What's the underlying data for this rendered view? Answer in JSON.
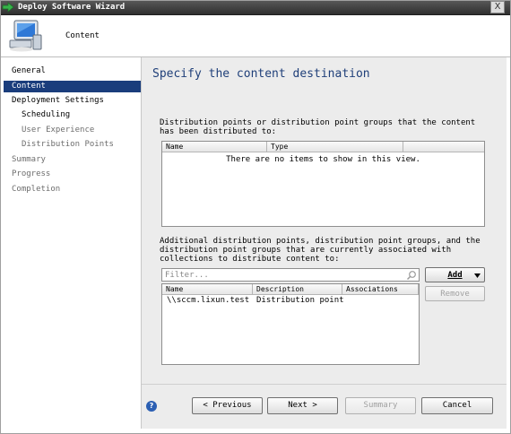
{
  "window": {
    "title": "Deploy Software Wizard",
    "close_label": "X"
  },
  "header": {
    "page_title": "Content"
  },
  "sidebar": {
    "items": [
      {
        "label": "General",
        "state": "done"
      },
      {
        "label": "Content",
        "state": "active"
      },
      {
        "label": "Deployment Settings",
        "state": "done"
      },
      {
        "label": "Scheduling",
        "state": "done"
      },
      {
        "label": "User Experience",
        "state": "dim"
      },
      {
        "label": "Distribution Points",
        "state": "dim"
      },
      {
        "label": "Summary",
        "state": "dim"
      },
      {
        "label": "Progress",
        "state": "dim"
      },
      {
        "label": "Completion",
        "state": "dim"
      }
    ]
  },
  "main": {
    "heading": "Specify the content destination",
    "distributed": {
      "description": "Distribution points or distribution point groups that the content has been distributed to:",
      "columns": [
        "Name",
        "Type"
      ],
      "empty_message": "There are no items to show in this view."
    },
    "associated": {
      "description": "Additional distribution points, distribution point groups, and the distribution point groups that are currently associated with collections to distribute content to:",
      "filter_placeholder": "Filter...",
      "columns": [
        "Name",
        "Description",
        "Associations"
      ],
      "rows": [
        {
          "name": "\\\\sccm.lixun.test",
          "description": "Distribution point",
          "associations": ""
        }
      ],
      "add_label": "Add",
      "remove_label": "Remove"
    }
  },
  "footer": {
    "previous_label": "< Previous",
    "next_label": "Next >",
    "summary_label": "Summary",
    "cancel_label": "Cancel"
  }
}
